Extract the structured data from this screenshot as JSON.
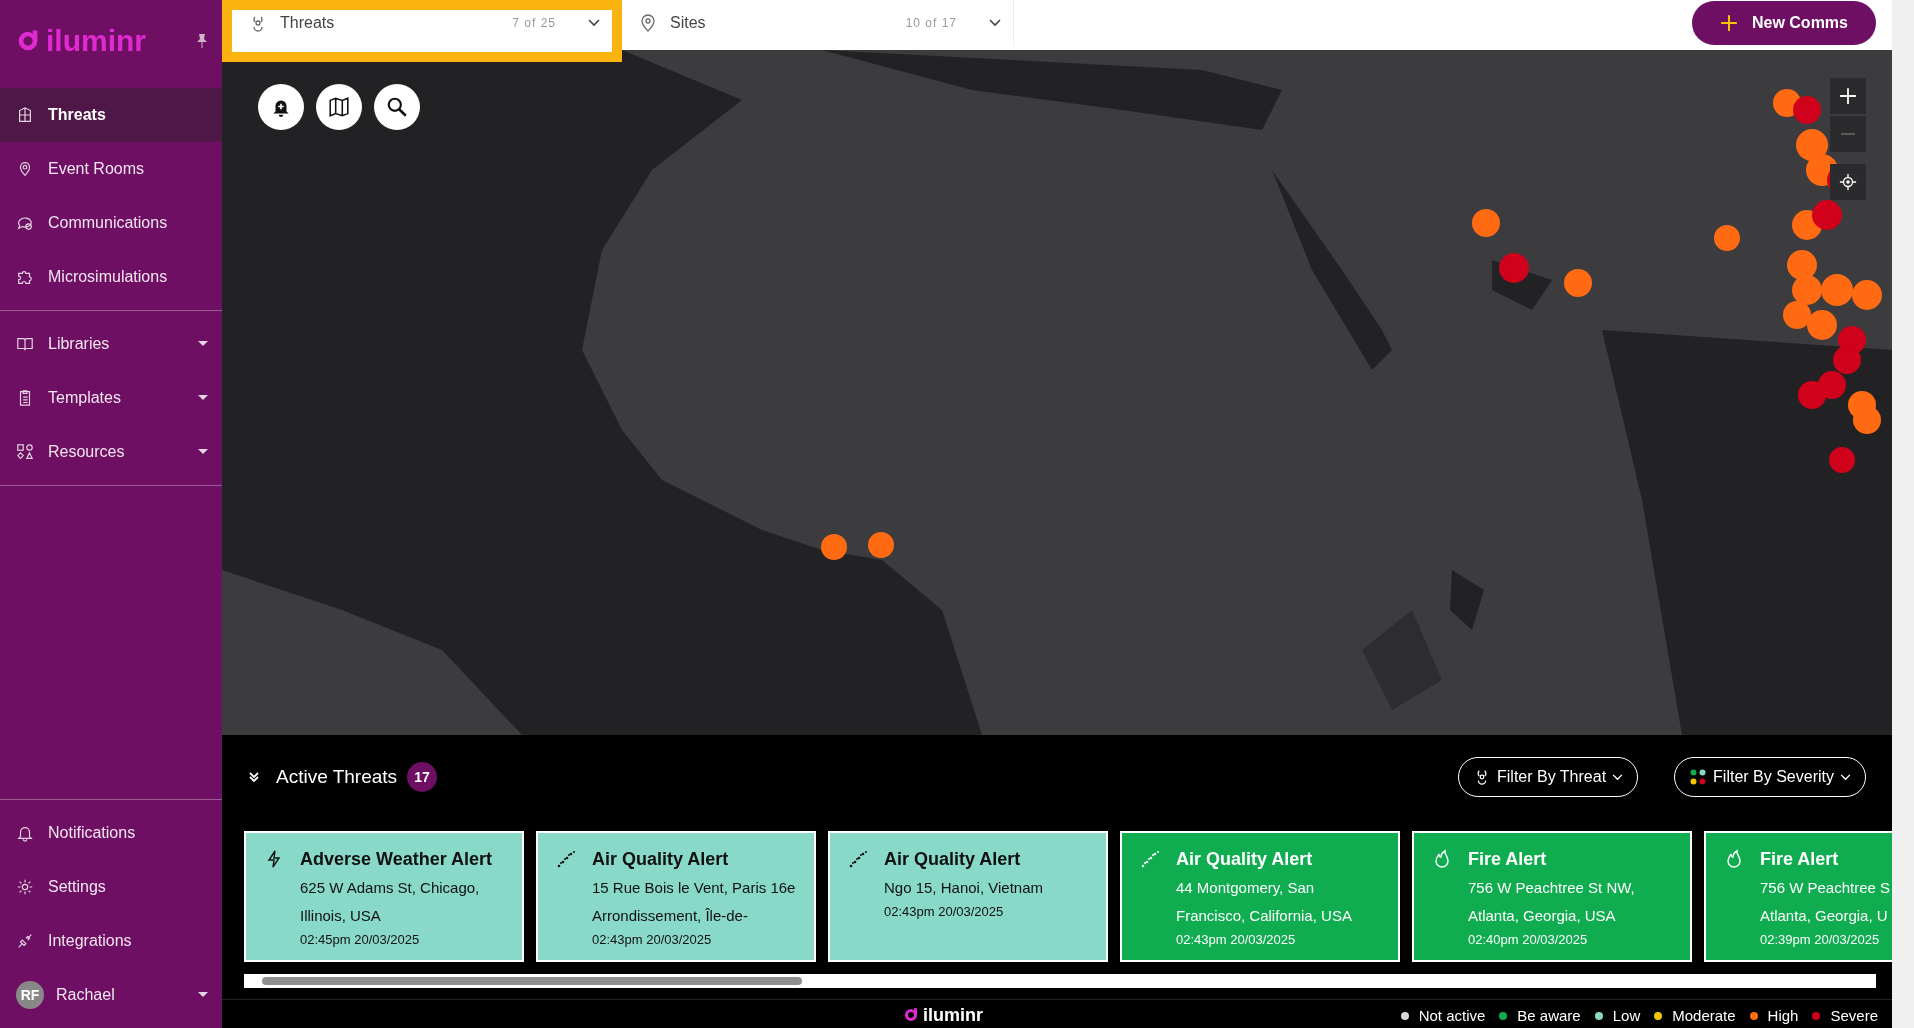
{
  "sidebar": {
    "logo": "iluminr",
    "items": [
      {
        "label": "Threats",
        "selected": true,
        "has_menu": false
      },
      {
        "label": "Event Rooms",
        "selected": false,
        "has_menu": false
      },
      {
        "label": "Communications",
        "selected": false,
        "has_menu": false
      },
      {
        "label": "Microsimulations",
        "selected": false,
        "has_menu": false
      }
    ],
    "groups": [
      {
        "label": "Libraries",
        "selected": false,
        "has_menu": true
      },
      {
        "label": "Templates",
        "selected": false,
        "has_menu": true
      },
      {
        "label": "Resources",
        "selected": false,
        "has_menu": true
      }
    ],
    "bottom_items": [
      {
        "label": "Notifications",
        "selected": false,
        "has_menu": false
      },
      {
        "label": "Settings",
        "selected": false,
        "has_menu": false
      },
      {
        "label": "Integrations",
        "selected": false,
        "has_menu": false
      }
    ],
    "user": {
      "initials": "RF",
      "name": "Rachael"
    }
  },
  "top_bar": {
    "filters": [
      {
        "label": "Threats",
        "count": "7 of 25",
        "selected": true
      },
      {
        "label": "Sites",
        "count": "10 of 17",
        "selected": false
      }
    ],
    "new_button": "New Comms"
  },
  "active_threats": {
    "title": "Active Threats",
    "count": "17",
    "filters": [
      "Filter By Threat",
      "Filter By Severity"
    ],
    "cards": [
      {
        "kind": "weather",
        "color": "#88d9c8",
        "title": "Adverse Weather Alert",
        "address": [
          "625 W Adams St, Chicago,",
          "Illinois, USA"
        ],
        "time": "02:45pm 20/03/2025"
      },
      {
        "kind": "air",
        "color": "#88d9c8",
        "title": "Air Quality Alert",
        "address": [
          "15 Rue Bois le Vent, Paris 16e",
          "Arrondissement, Île-de-"
        ],
        "time": "02:43pm 20/03/2025"
      },
      {
        "kind": "air",
        "color": "#88d9c8",
        "title": "Air Quality Alert",
        "address": [
          "Ngo 15, Hanoi, Vietnam"
        ],
        "time": "02:43pm 20/03/2025"
      },
      {
        "kind": "air",
        "color": "#0fad4f",
        "title": "Air Quality Alert",
        "address": [
          "44 Montgomery, San",
          "Francisco, California, USA"
        ],
        "time": "02:43pm 20/03/2025"
      },
      {
        "kind": "fire",
        "color": "#0fad4f",
        "title": "Fire Alert",
        "address": [
          "756 W Peachtree St NW,",
          "Atlanta, Georgia, USA"
        ],
        "time": "02:40pm 20/03/2025"
      },
      {
        "kind": "fire",
        "color": "#0fad4f",
        "title": "Fire Alert",
        "address": [
          "756 W Peachtree S",
          "Atlanta, Georgia, U"
        ],
        "time": "02:39pm 20/03/2025"
      }
    ]
  },
  "footer": {
    "logo": "iluminr",
    "legend": [
      {
        "label": "Not active",
        "color": "#d9d9d9"
      },
      {
        "label": "Be aware",
        "color": "#0fad4f"
      },
      {
        "label": "Low",
        "color": "#88d9c8"
      },
      {
        "label": "Moderate",
        "color": "#f5c400"
      },
      {
        "label": "High",
        "color": "#ff6a13"
      },
      {
        "label": "Severe",
        "color": "#d0021b"
      }
    ]
  }
}
